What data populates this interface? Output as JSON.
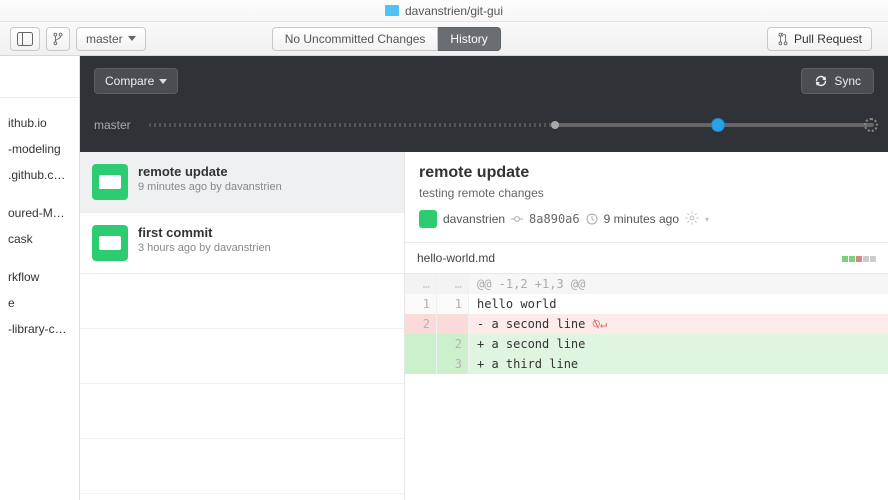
{
  "title": {
    "repo": "davanstrien/git-gui"
  },
  "toolbar": {
    "branch_name": "master",
    "seg_changes": "No Uncommitted Changes",
    "seg_history": "History",
    "pull_request": "Pull Request"
  },
  "dark": {
    "compare_label": "Compare",
    "sync_label": "Sync",
    "branch_label": "master"
  },
  "sidebar": {
    "items": [
      "",
      "ithub.io",
      "-modeling",
      ".github.c…",
      "",
      "oured-M…",
      "cask",
      "",
      "rkflow",
      "e",
      "-library-c…"
    ]
  },
  "commits": [
    {
      "title": "remote update",
      "meta": "9 minutes ago by davanstrien",
      "selected": true
    },
    {
      "title": "first commit",
      "meta": "3 hours ago by davanstrien",
      "selected": false
    }
  ],
  "detail": {
    "title": "remote update",
    "description": "testing remote changes",
    "author": "davanstrien",
    "sha": "8a890a6",
    "time": "9 minutes ago",
    "file": "hello-world.md",
    "diff": {
      "hunk": "@@ -1,2 +1,3 @@",
      "rows": [
        {
          "type": "ctx",
          "old": "1",
          "new": "1",
          "text": "hello world"
        },
        {
          "type": "del",
          "old": "2",
          "new": "",
          "text": "- a second line",
          "eol": true
        },
        {
          "type": "add",
          "old": "",
          "new": "2",
          "text": "+ a second line"
        },
        {
          "type": "add",
          "old": "",
          "new": "3",
          "text": "+ a third line"
        }
      ]
    }
  }
}
